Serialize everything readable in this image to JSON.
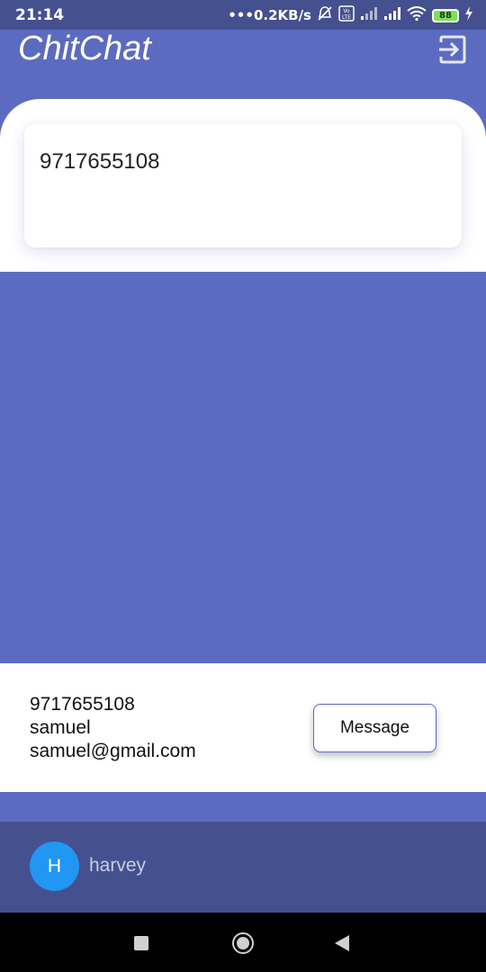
{
  "status_bar": {
    "time": "21:14",
    "network_speed": "•••0.2KB/s",
    "battery_level": "88",
    "icons": [
      "mute-alarm-icon",
      "volte-icon",
      "signal-icon",
      "signal-icon",
      "wifi-icon",
      "battery-icon",
      "charging-icon"
    ]
  },
  "app_bar": {
    "title": "ChitChat",
    "logout_icon": "logout-icon"
  },
  "search": {
    "value": "9717655108"
  },
  "result": {
    "phone": "9717655108",
    "name": "samuel",
    "email": "samuel@gmail.com",
    "message_label": "Message"
  },
  "user": {
    "avatar_initial": "H",
    "name": "harvey",
    "avatar_color": "#2196f3"
  },
  "colors": {
    "primary": "#5c6bc0",
    "primary_dark": "#45508f",
    "surface": "#ffffff"
  },
  "nav_bar": {
    "buttons": [
      "recents-icon",
      "home-icon",
      "back-icon"
    ]
  }
}
